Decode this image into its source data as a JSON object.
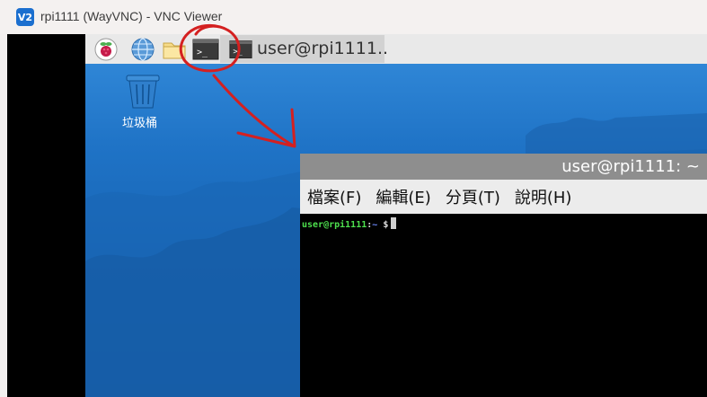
{
  "window": {
    "logo_text": "V2",
    "title": "rpi1111 (WayVNC) - VNC Viewer"
  },
  "panel": {
    "menu_icon": "raspberry-icon",
    "browser_icon": "globe-icon",
    "files_icon": "folder-icon",
    "terminal_launcher_icon": "terminal-icon",
    "taskbar_icon": "terminal-icon",
    "taskbar_label": "user@rpi1111.."
  },
  "desktop": {
    "trash_label": "垃圾桶"
  },
  "terminal": {
    "title": "user@rpi1111: ~",
    "menus": [
      "檔案(F)",
      "編輯(E)",
      "分頁(T)",
      "說明(H)"
    ],
    "prompt_user": "user@rpi1111",
    "prompt_sep": ":",
    "prompt_path": "~",
    "prompt_symbol": "$"
  },
  "colors": {
    "annotation": "#d42020",
    "desktop_blue": "#1f73c6",
    "vnc_brand": "#1b6fcf"
  }
}
